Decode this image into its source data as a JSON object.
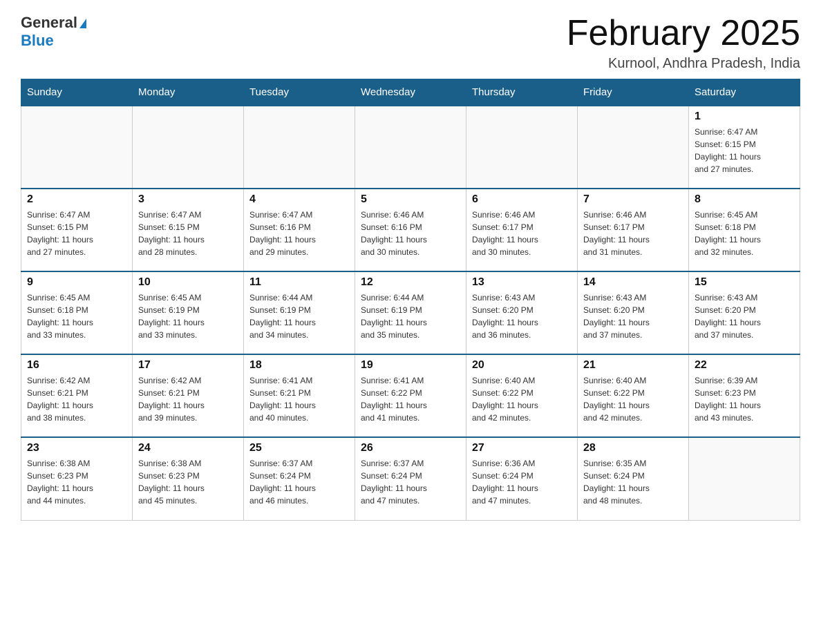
{
  "logo": {
    "general": "General",
    "blue": "Blue"
  },
  "title": "February 2025",
  "subtitle": "Kurnool, Andhra Pradesh, India",
  "days_header": [
    "Sunday",
    "Monday",
    "Tuesday",
    "Wednesday",
    "Thursday",
    "Friday",
    "Saturday"
  ],
  "weeks": [
    [
      {
        "day": "",
        "info": ""
      },
      {
        "day": "",
        "info": ""
      },
      {
        "day": "",
        "info": ""
      },
      {
        "day": "",
        "info": ""
      },
      {
        "day": "",
        "info": ""
      },
      {
        "day": "",
        "info": ""
      },
      {
        "day": "1",
        "info": "Sunrise: 6:47 AM\nSunset: 6:15 PM\nDaylight: 11 hours\nand 27 minutes."
      }
    ],
    [
      {
        "day": "2",
        "info": "Sunrise: 6:47 AM\nSunset: 6:15 PM\nDaylight: 11 hours\nand 27 minutes."
      },
      {
        "day": "3",
        "info": "Sunrise: 6:47 AM\nSunset: 6:15 PM\nDaylight: 11 hours\nand 28 minutes."
      },
      {
        "day": "4",
        "info": "Sunrise: 6:47 AM\nSunset: 6:16 PM\nDaylight: 11 hours\nand 29 minutes."
      },
      {
        "day": "5",
        "info": "Sunrise: 6:46 AM\nSunset: 6:16 PM\nDaylight: 11 hours\nand 30 minutes."
      },
      {
        "day": "6",
        "info": "Sunrise: 6:46 AM\nSunset: 6:17 PM\nDaylight: 11 hours\nand 30 minutes."
      },
      {
        "day": "7",
        "info": "Sunrise: 6:46 AM\nSunset: 6:17 PM\nDaylight: 11 hours\nand 31 minutes."
      },
      {
        "day": "8",
        "info": "Sunrise: 6:45 AM\nSunset: 6:18 PM\nDaylight: 11 hours\nand 32 minutes."
      }
    ],
    [
      {
        "day": "9",
        "info": "Sunrise: 6:45 AM\nSunset: 6:18 PM\nDaylight: 11 hours\nand 33 minutes."
      },
      {
        "day": "10",
        "info": "Sunrise: 6:45 AM\nSunset: 6:19 PM\nDaylight: 11 hours\nand 33 minutes."
      },
      {
        "day": "11",
        "info": "Sunrise: 6:44 AM\nSunset: 6:19 PM\nDaylight: 11 hours\nand 34 minutes."
      },
      {
        "day": "12",
        "info": "Sunrise: 6:44 AM\nSunset: 6:19 PM\nDaylight: 11 hours\nand 35 minutes."
      },
      {
        "day": "13",
        "info": "Sunrise: 6:43 AM\nSunset: 6:20 PM\nDaylight: 11 hours\nand 36 minutes."
      },
      {
        "day": "14",
        "info": "Sunrise: 6:43 AM\nSunset: 6:20 PM\nDaylight: 11 hours\nand 37 minutes."
      },
      {
        "day": "15",
        "info": "Sunrise: 6:43 AM\nSunset: 6:20 PM\nDaylight: 11 hours\nand 37 minutes."
      }
    ],
    [
      {
        "day": "16",
        "info": "Sunrise: 6:42 AM\nSunset: 6:21 PM\nDaylight: 11 hours\nand 38 minutes."
      },
      {
        "day": "17",
        "info": "Sunrise: 6:42 AM\nSunset: 6:21 PM\nDaylight: 11 hours\nand 39 minutes."
      },
      {
        "day": "18",
        "info": "Sunrise: 6:41 AM\nSunset: 6:21 PM\nDaylight: 11 hours\nand 40 minutes."
      },
      {
        "day": "19",
        "info": "Sunrise: 6:41 AM\nSunset: 6:22 PM\nDaylight: 11 hours\nand 41 minutes."
      },
      {
        "day": "20",
        "info": "Sunrise: 6:40 AM\nSunset: 6:22 PM\nDaylight: 11 hours\nand 42 minutes."
      },
      {
        "day": "21",
        "info": "Sunrise: 6:40 AM\nSunset: 6:22 PM\nDaylight: 11 hours\nand 42 minutes."
      },
      {
        "day": "22",
        "info": "Sunrise: 6:39 AM\nSunset: 6:23 PM\nDaylight: 11 hours\nand 43 minutes."
      }
    ],
    [
      {
        "day": "23",
        "info": "Sunrise: 6:38 AM\nSunset: 6:23 PM\nDaylight: 11 hours\nand 44 minutes."
      },
      {
        "day": "24",
        "info": "Sunrise: 6:38 AM\nSunset: 6:23 PM\nDaylight: 11 hours\nand 45 minutes."
      },
      {
        "day": "25",
        "info": "Sunrise: 6:37 AM\nSunset: 6:24 PM\nDaylight: 11 hours\nand 46 minutes."
      },
      {
        "day": "26",
        "info": "Sunrise: 6:37 AM\nSunset: 6:24 PM\nDaylight: 11 hours\nand 47 minutes."
      },
      {
        "day": "27",
        "info": "Sunrise: 6:36 AM\nSunset: 6:24 PM\nDaylight: 11 hours\nand 47 minutes."
      },
      {
        "day": "28",
        "info": "Sunrise: 6:35 AM\nSunset: 6:24 PM\nDaylight: 11 hours\nand 48 minutes."
      },
      {
        "day": "",
        "info": ""
      }
    ]
  ]
}
